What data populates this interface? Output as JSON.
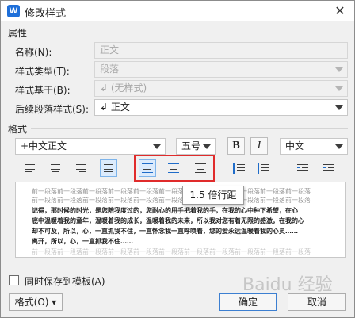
{
  "window": {
    "title": "修改样式",
    "app_icon_letter": "W"
  },
  "attributes": {
    "section_label": "属性",
    "name_label": "名称(N):",
    "name_value": "正文",
    "style_type_label": "样式类型(T):",
    "style_type_value": "段落",
    "based_on_label": "样式基于(B):",
    "based_on_value": "↲ (无样式)",
    "next_style_label": "后续段落样式(S):",
    "next_style_value": "↲ 正文"
  },
  "format": {
    "section_label": "格式",
    "font_value": "+中文正文",
    "size_value": "五号",
    "bold_label": "B",
    "italic_label": "I",
    "script_value": "中文",
    "line_spacing_tooltip": "1.5 倍行距"
  },
  "preview": {
    "previous_paragraph": "前一段落前一段落前一段落前一段落前一段落前一段落前一段落前一段落前一段落前一段落前一段落",
    "sample_lines": [
      "记得，那时候的时光，是您陪我度过的，您耐心的用手把着我的手，在我的心中种下希望，在心",
      "底中温暖着我的童年，温暖着我的成长，温暖着我的未来，所以我对您有着无限的感激，在我的心",
      "却不可及，所以，心，一直抓我不住，一直怀念我一直呼唤着，您的爱永远温暖着我的心灵……",
      "离开，所以，心，一直抓我不住……"
    ]
  },
  "bottom": {
    "save_to_template_label": "同时保存到模板(A)",
    "format_button_label": "格式(O) ▾",
    "ok_label": "确定",
    "cancel_label": "取消"
  },
  "watermark": "Baidu 经验"
}
